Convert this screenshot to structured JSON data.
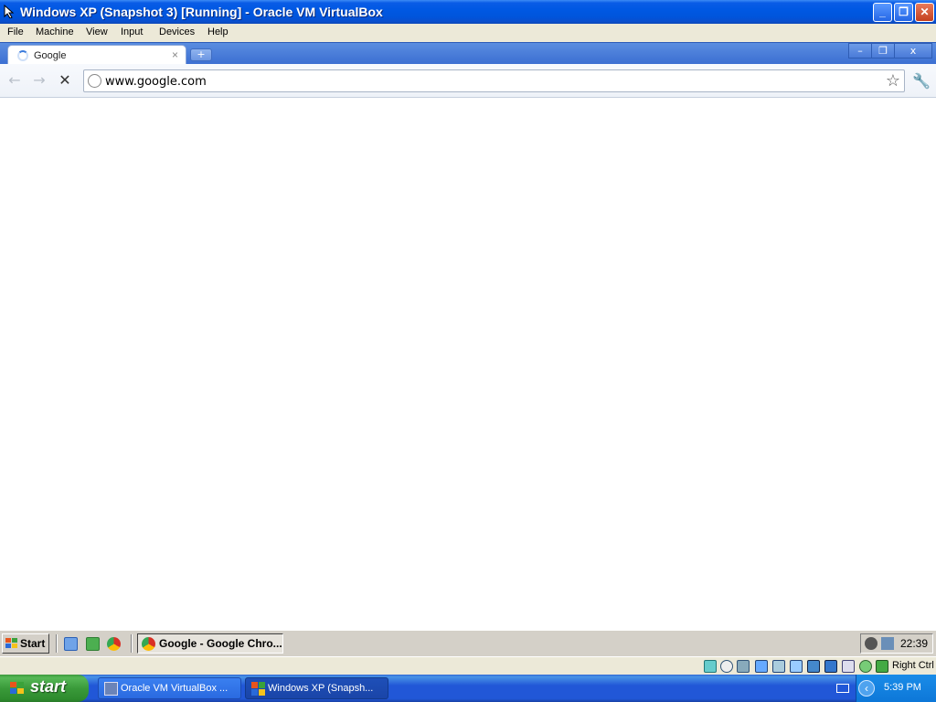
{
  "host_window": {
    "title": "Windows XP (Snapshot 3) [Running] - Oracle VM VirtualBox",
    "controls": {
      "minimize": "_",
      "restore": "❐",
      "close": "✕"
    }
  },
  "menu": [
    "File",
    "Machine",
    "View",
    "Input",
    "Devices",
    "Help"
  ],
  "browser": {
    "tab_title": "Google",
    "tab_close": "×",
    "new_tab": "+",
    "url": "www.google.com",
    "window_controls": {
      "minimize": "–",
      "restore": "❐",
      "close": "x"
    },
    "back": "←",
    "forward": "→",
    "stop": "✕",
    "star": "☆",
    "wrench": "🔧"
  },
  "guest_taskbar": {
    "start_label": "Start",
    "task_label": "Google - Google Chro...",
    "clock": "22:39"
  },
  "vbox_status": {
    "host_key": "Right Ctrl"
  },
  "host_taskbar": {
    "start_label": "start",
    "tasks": [
      "Oracle VM VirtualBox ...",
      "Windows XP (Snapsh..."
    ],
    "clock": "5:39 PM",
    "tray_arrow": "‹"
  },
  "colors": {
    "xp_blue": "#0058e3",
    "xp_green": "#3a9a3a",
    "classic_gray": "#d4d0c8",
    "luna_beige": "#ece9d8"
  }
}
